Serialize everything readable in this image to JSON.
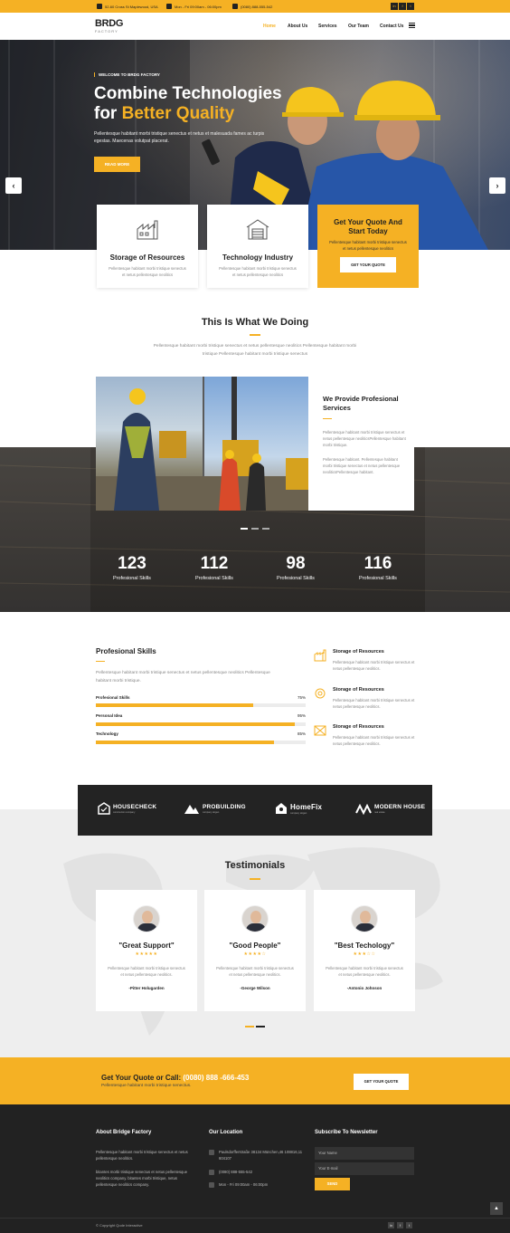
{
  "topbar": {
    "address": "52-60 Cross St Maplewood, USA",
    "hours": "Mon - Fri 09:00am - 06:00pm",
    "phone": "(0080) 888-555-542",
    "social": [
      "in",
      "f",
      "t"
    ]
  },
  "nav": {
    "logo": "BRDG",
    "logo_sub": "FACTORY",
    "links": [
      "Home",
      "About Us",
      "Services",
      "Our Team",
      "Contact Us"
    ],
    "active_color": "#f5b124"
  },
  "hero": {
    "kicker": "WELCOME TO BRDG FACTORY",
    "title_line1": "Combine Technologies",
    "title_line2_prefix": "for ",
    "title_line2_highlight": "Better Quality",
    "desc": "Pellentesque habitant morbi tristique senectus et netus et malesuada fames ac turpis egestas. Maecenas volutpat placerat.",
    "button": "READ MORE",
    "prev": "‹",
    "next": "›"
  },
  "features": [
    {
      "title": "Storage of Resources",
      "desc": "Pellentesque habitant morbi tristique senectus et netus pellentesque neolitics"
    },
    {
      "title": "Technology Industry",
      "desc": "Pellentesque habitant morbi tristique senectus et netus pellentesque neolitics"
    }
  ],
  "quote_card": {
    "title": "Get Your Quote And Start Today",
    "desc": "Pellentesque habitant morbi tristique senectus et netus pellentesque neolitics",
    "button": "GET YOUR QUOTE"
  },
  "doing": {
    "title": "This Is What We Doing",
    "desc": "Pellentesque habitant morbi tristique senectus et netus pellentesque neolitics Pellentesque habitant morbi tristique Pellentesque habitant morbi tristique senectus"
  },
  "provide": {
    "title": "We Provide Profesional Services",
    "p1": "Pellentesque habitant morbi tristique senectus et netus pellentesque neoliticsPellentesque habitant morbi tristique.",
    "p2": "Pellentesque habitant. Pellentesque habitant morbi tristique senectus et netus pellentesque neoliticsPellentesque habitant."
  },
  "stats": [
    {
      "value": "123",
      "label": "Profesional Skills"
    },
    {
      "value": "112",
      "label": "Profesional Skills"
    },
    {
      "value": "98",
      "label": "Profesional Skills"
    },
    {
      "value": "116",
      "label": "Profesional Skills"
    }
  ],
  "skills": {
    "title": "Profesional Skills",
    "desc": "Pellentesque habitant morbi tristique senectus et netus pellentesque neolitics Pellentesque habitant morbi tristique.",
    "bars": [
      {
        "label": "Profesional Skills",
        "pct": "75%",
        "value": 0.75
      },
      {
        "label": "Personal Idea",
        "pct": "95%",
        "value": 0.95
      },
      {
        "label": "Technology",
        "pct": "85%",
        "value": 0.85
      }
    ]
  },
  "services": [
    {
      "title": "Storage of Resources",
      "desc": "Pellentesque habitant morbi tristique senectus et netus pellentesque neolitics."
    },
    {
      "title": "Storage of Resources",
      "desc": "Pellentesque habitant morbi tristique senectus et netus pellentesque neolitics."
    },
    {
      "title": "Storage of Resources",
      "desc": "Pellentesque habitant morbi tristique senectus et netus pellentesque neolitics."
    }
  ],
  "brands": [
    {
      "name": "HOUSECHECK",
      "sub": "construction company"
    },
    {
      "name": "PROBUILDING",
      "sub": "company slogan"
    },
    {
      "name": "HomeFix",
      "sub": "company slogan"
    },
    {
      "name": "MODERN HOUSE",
      "sub": "real estate"
    }
  ],
  "testimonials": {
    "title": "Testimonials",
    "items": [
      {
        "quote": "\"Great Support\"",
        "stars": "★★★★★",
        "desc": "Pellentesque habitant morbi tristique senectus et netus pellentesque neolitics.",
        "name": "-Pitter Holugarden"
      },
      {
        "quote": "\"Good People\"",
        "stars": "★★★★☆",
        "desc": "Pellentesque habitant morbi tristique senectus et netus pellentesque neolitics.",
        "name": "-George Wilson"
      },
      {
        "quote": "\"Best Techology\"",
        "stars": "★★★☆☆",
        "desc": "Pellentesque habitant morbi tristique senectus et netus pellentesque neolitics.",
        "name": "-Antonio Johnson"
      }
    ]
  },
  "cta": {
    "title": "Get Your Quote or Call: ",
    "phone": "(0080) 888 -666-453",
    "desc": "Pellentesque habitant morbi tristique senectus.",
    "button": "GET YOUR QUOTE"
  },
  "footer": {
    "about_title": "About Bridge Factory",
    "about_p1": "Pellentesque habitant morbi tristique senectus et netus pellentesque neolitics.",
    "about_p2": "bitantes morbi tristique senectus et netus pellentesque neolitics company. bitantes morbi tristique, netus pellentesque neolitics company.",
    "location_title": "Our Location",
    "address": "Paulsdorfferstraße 38134 München,46 108816,11 604107",
    "phone": "(0080) 888-555-542",
    "hours": "Mon - Fri 09:00am - 06:00pm",
    "news_title": "Subscribe To Newsletter",
    "name_placeholder": "Your Name",
    "email_placeholder": "Your E-mail",
    "send": "SEND",
    "copyright": "© Copyright Qode Interactive",
    "social": [
      "in",
      "f",
      "t"
    ],
    "to_top": "▲"
  }
}
